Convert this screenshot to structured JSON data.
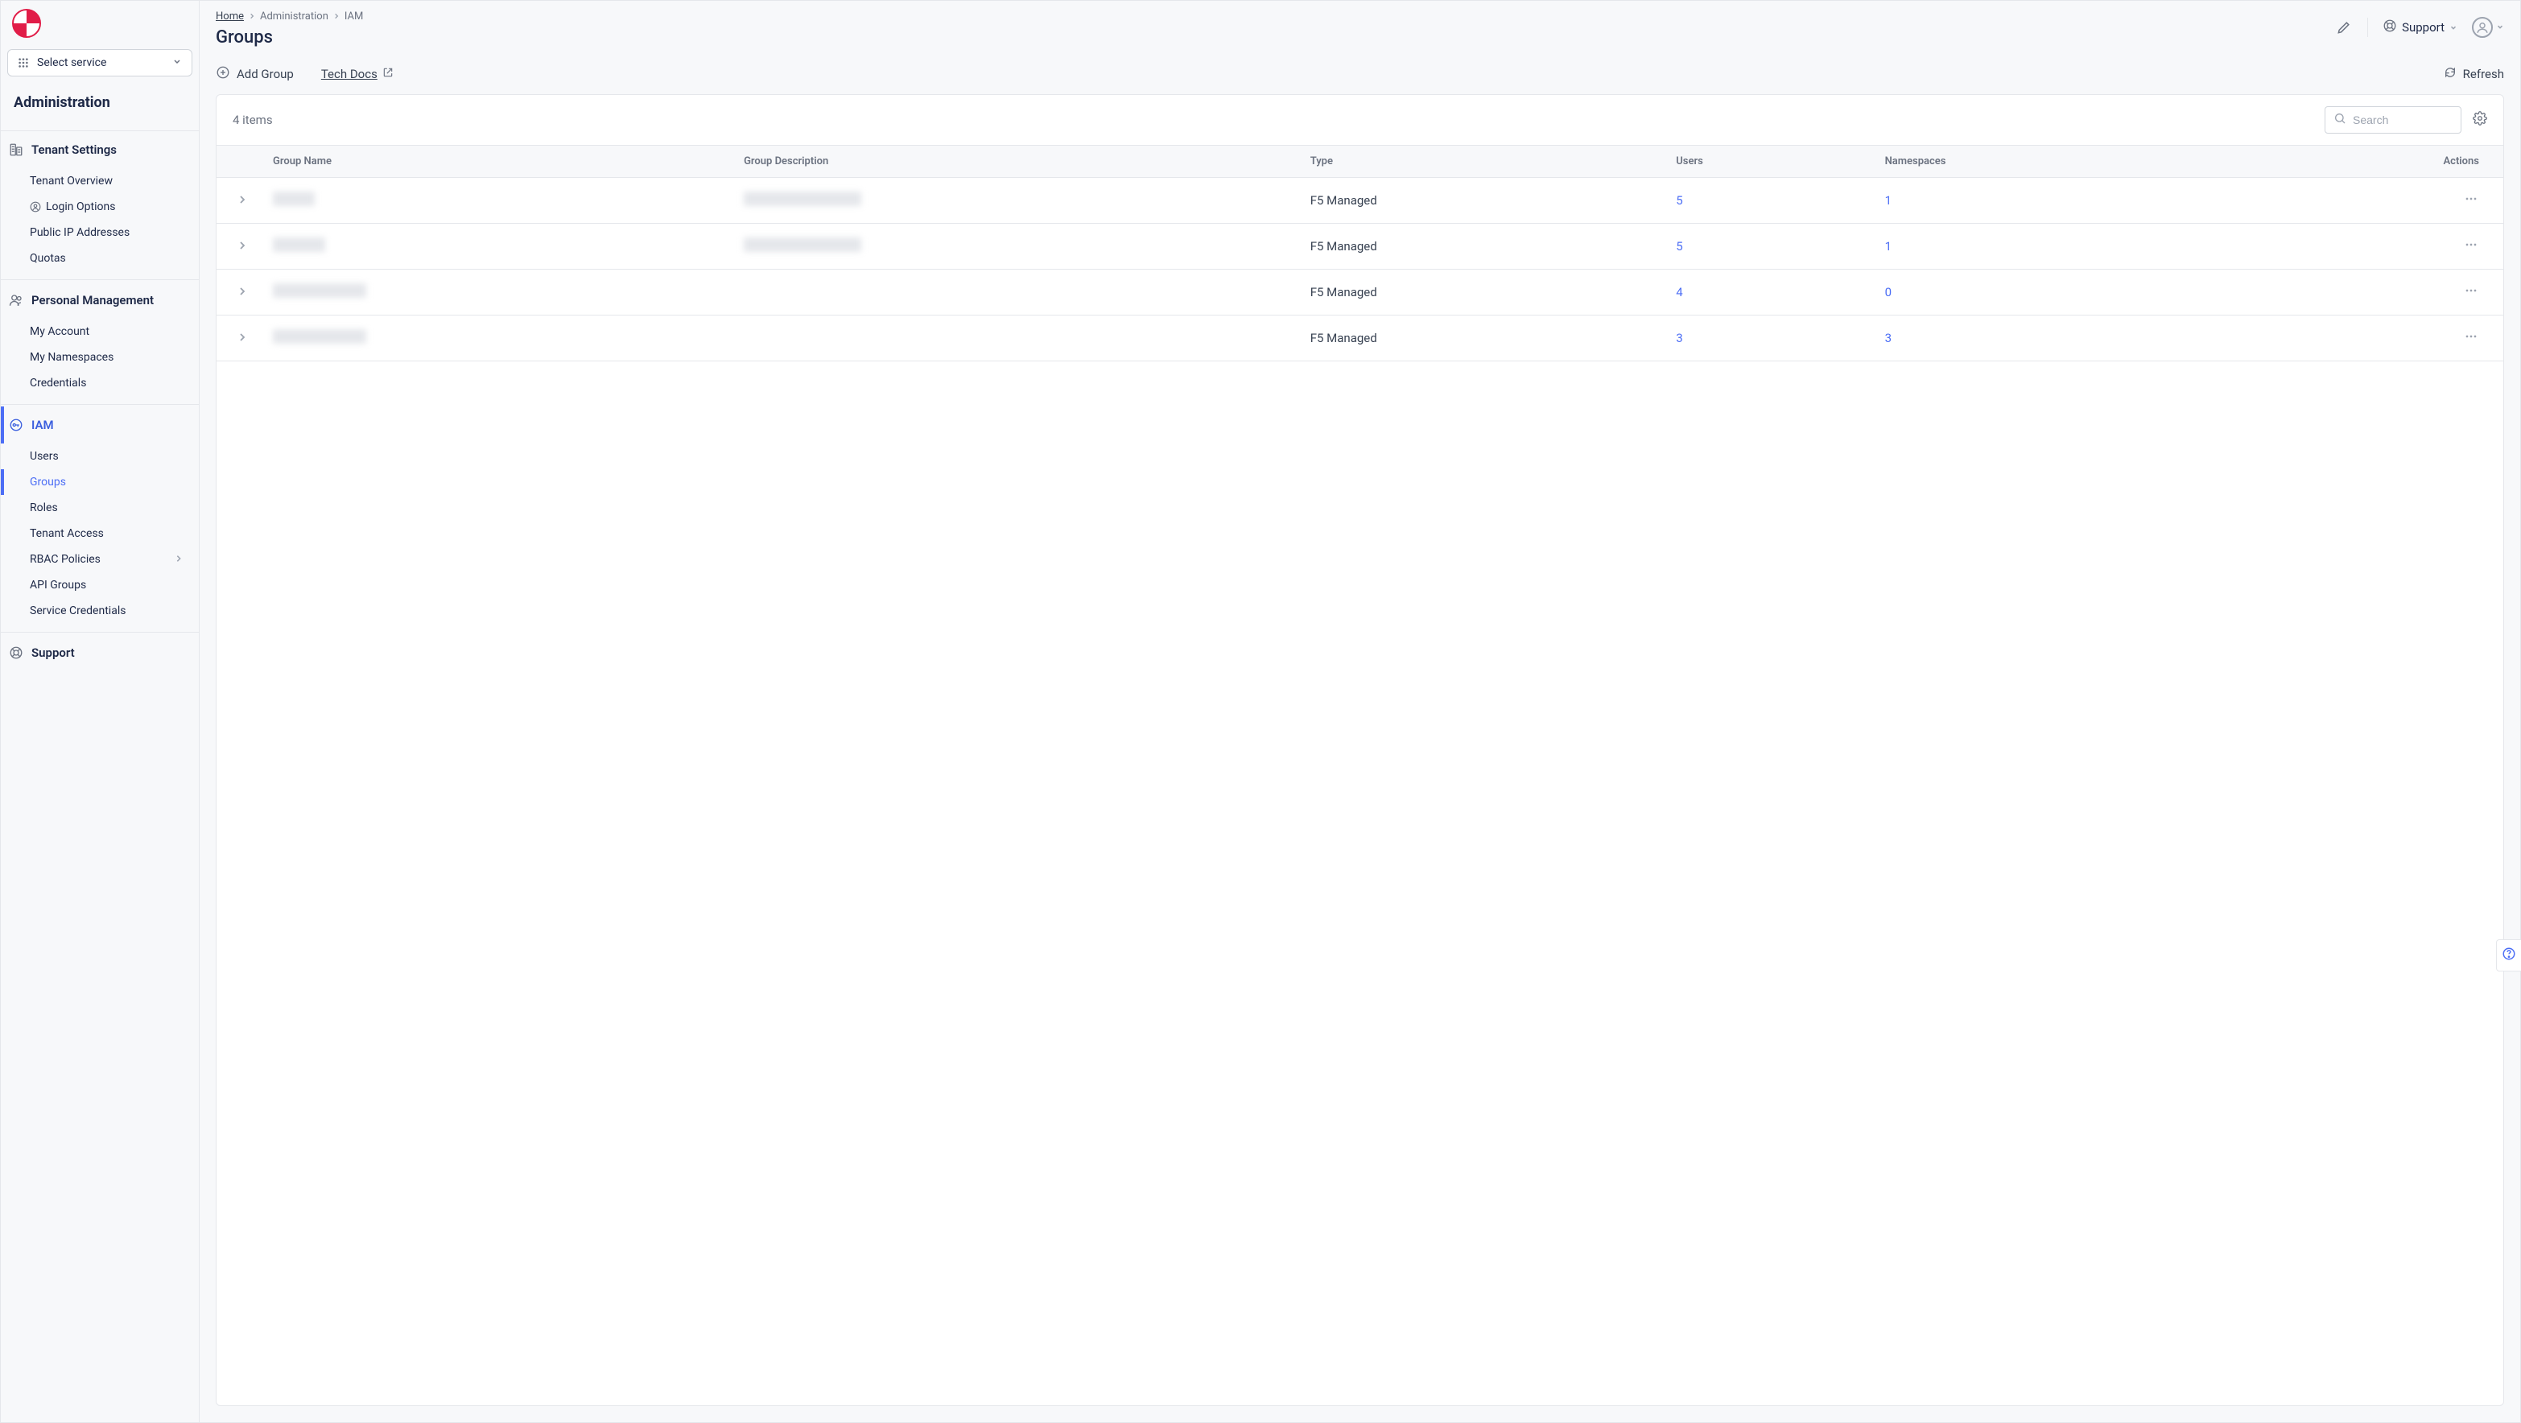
{
  "service_selector": {
    "label": "Select service"
  },
  "admin_title": "Administration",
  "sidebar": {
    "sections": [
      {
        "label": "Tenant Settings",
        "items": [
          {
            "label": "Tenant Overview"
          },
          {
            "label": "Login Options"
          },
          {
            "label": "Public IP Addresses"
          },
          {
            "label": "Quotas"
          }
        ]
      },
      {
        "label": "Personal Management",
        "items": [
          {
            "label": "My Account"
          },
          {
            "label": "My Namespaces"
          },
          {
            "label": "Credentials"
          }
        ]
      },
      {
        "label": "IAM",
        "items": [
          {
            "label": "Users"
          },
          {
            "label": "Groups"
          },
          {
            "label": "Roles"
          },
          {
            "label": "Tenant Access"
          },
          {
            "label": "RBAC Policies"
          },
          {
            "label": "API Groups"
          },
          {
            "label": "Service Credentials"
          }
        ]
      },
      {
        "label": "Support",
        "items": []
      }
    ]
  },
  "breadcrumbs": {
    "home": "Home",
    "admin": "Administration",
    "iam": "IAM"
  },
  "page_title": "Groups",
  "header": {
    "support_label": "Support"
  },
  "toolbar": {
    "add_group": "Add Group",
    "tech_docs": "Tech Docs",
    "refresh": "Refresh"
  },
  "table": {
    "item_count": "4 items",
    "search_placeholder": "Search",
    "columns": {
      "group_name": "Group Name",
      "group_description": "Group Description",
      "type": "Type",
      "users": "Users",
      "namespaces": "Namespaces",
      "actions": "Actions"
    },
    "rows": [
      {
        "name_w": 52,
        "desc_w": 146,
        "type": "F5 Managed",
        "users": "5",
        "namespaces": "1"
      },
      {
        "name_w": 65,
        "desc_w": 146,
        "type": "F5 Managed",
        "users": "5",
        "namespaces": "1"
      },
      {
        "name_w": 116,
        "desc_w": 0,
        "type": "F5 Managed",
        "users": "4",
        "namespaces": "0"
      },
      {
        "name_w": 116,
        "desc_w": 0,
        "type": "F5 Managed",
        "users": "3",
        "namespaces": "3"
      }
    ]
  }
}
